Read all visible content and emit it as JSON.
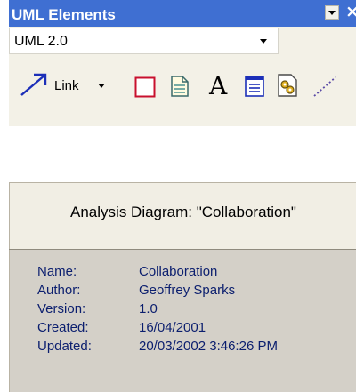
{
  "toolbox": {
    "title": "UML Elements",
    "close_glyph": "×",
    "combo": {
      "value": "UML 2.0"
    },
    "tools": [
      {
        "name": "link-tool",
        "label": "Link",
        "icon": "diagonal-arrow-icon"
      },
      {
        "name": "boundary-tool",
        "icon": "red-square-icon"
      },
      {
        "name": "note-tool",
        "icon": "document-icon"
      },
      {
        "name": "text-tool",
        "icon": "letter-a-icon",
        "glyph": "A"
      },
      {
        "name": "hyperlink-tool",
        "icon": "document-lines-icon"
      },
      {
        "name": "diagram-frame-tool",
        "icon": "gears-icon"
      },
      {
        "name": "note-link-tool",
        "icon": "dotted-line-icon"
      }
    ],
    "colors": {
      "title_bar": "#3f6fd2",
      "body": "#f3f1e7",
      "link_icon": "#1c2fb8",
      "boundary_icon": "#c8102e"
    }
  },
  "diagram": {
    "title": "Analysis Diagram: \"Collaboration\"",
    "properties": [
      {
        "label": "Name:",
        "value": "Collaboration"
      },
      {
        "label": "Author:",
        "value": "Geoffrey Sparks"
      },
      {
        "label": "Version:",
        "value": "1.0"
      },
      {
        "label": "Created:",
        "value": "16/04/2001"
      },
      {
        "label": "Updated:",
        "value": "20/03/2002 3:46:26 PM"
      }
    ],
    "colors": {
      "header": "#f1eee4",
      "body": "#d4d0c8",
      "text": "#0b1e6e"
    }
  }
}
